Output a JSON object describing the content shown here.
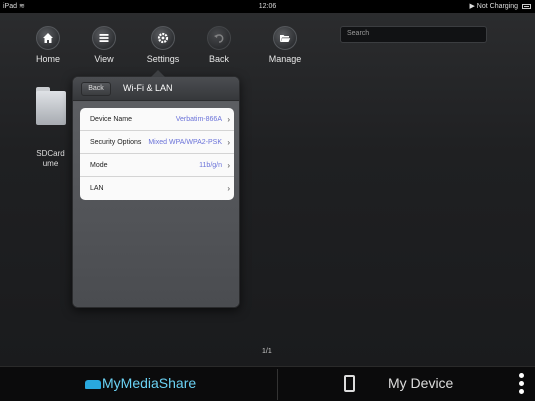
{
  "status_bar": {
    "device": "iPad",
    "time": "12:06",
    "charging": "Not Charging"
  },
  "toolbar": {
    "home_label": "Home",
    "view_label": "View",
    "settings_label": "Settings",
    "back_label": "Back",
    "manage_label": "Manage"
  },
  "search": {
    "placeholder": "Search"
  },
  "folder": {
    "label": "SDCard ume"
  },
  "popover": {
    "back_label": "Back",
    "title": "Wi-Fi & LAN",
    "rows": [
      {
        "label": "Device Name",
        "value": "Verbatim-866A"
      },
      {
        "label": "Security Options",
        "value": "Mixed WPA/WPA2-PSK"
      },
      {
        "label": "Mode",
        "value": "11b/g/n"
      },
      {
        "label": "LAN",
        "value": ""
      }
    ]
  },
  "pager": {
    "text": "1/1"
  },
  "bottom_bar": {
    "brand": "MyMediaShare",
    "my_device": "My Device"
  },
  "colors": {
    "accent_blue": "#6bd2f4",
    "value_text": "#6b73d9",
    "background": "#1e1f21"
  }
}
